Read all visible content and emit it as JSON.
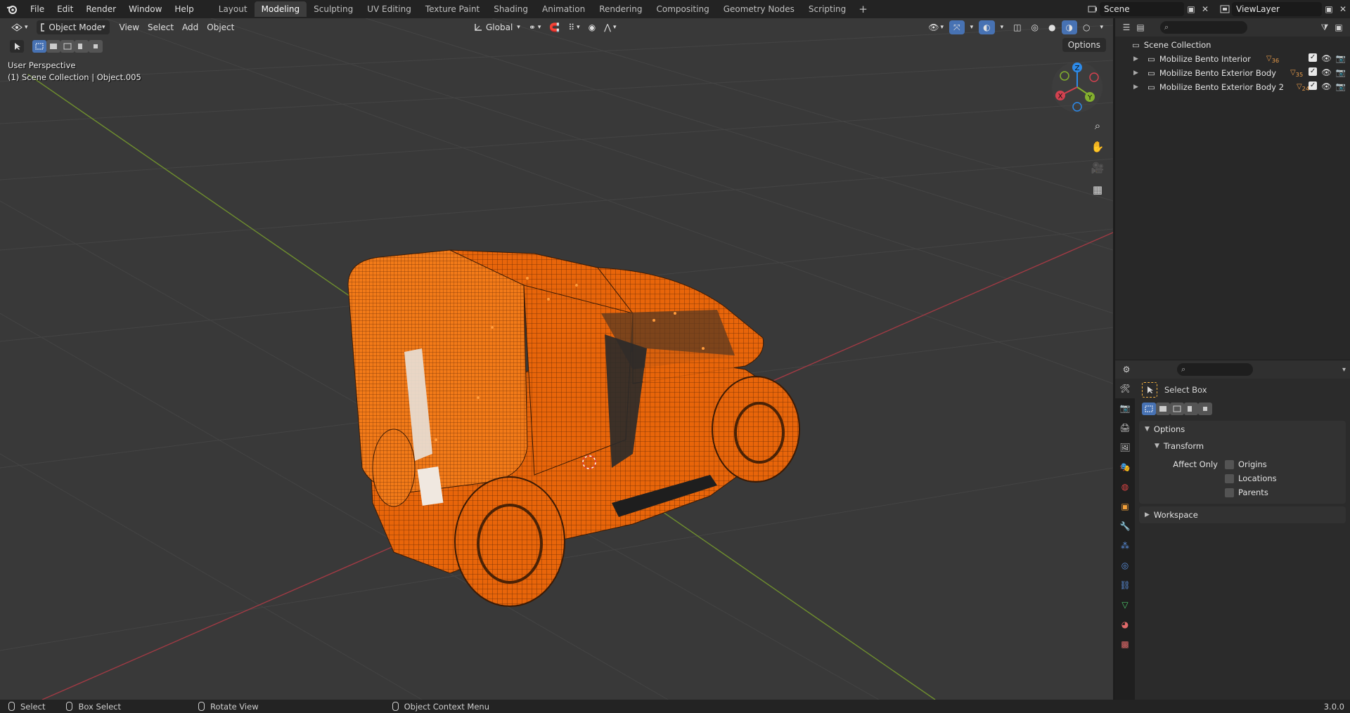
{
  "menu": [
    "File",
    "Edit",
    "Render",
    "Window",
    "Help"
  ],
  "workspaces": [
    "Layout",
    "Modeling",
    "Sculpting",
    "UV Editing",
    "Texture Paint",
    "Shading",
    "Animation",
    "Rendering",
    "Compositing",
    "Geometry Nodes",
    "Scripting"
  ],
  "active_workspace": "Modeling",
  "scene_name": "Scene",
  "view_layer": "ViewLayer",
  "viewport": {
    "mode": "Object Mode",
    "menus": [
      "View",
      "Select",
      "Add",
      "Object"
    ],
    "transform_orientation": "Global",
    "options_label": "Options",
    "perspective_label": "User Perspective",
    "collection_label": "(1) Scene Collection | Object.005",
    "gizmo_axes": {
      "x": "X",
      "y": "Y",
      "z": "Z"
    }
  },
  "outliner": {
    "root": "Scene Collection",
    "items": [
      {
        "label": "Mobilize Bento Interior",
        "badge": "36"
      },
      {
        "label": "Mobilize Bento Exterior Body",
        "badge": "35"
      },
      {
        "label": "Mobilize Bento Exterior Body 2",
        "badge": "24"
      }
    ]
  },
  "properties": {
    "tool_name": "Select Box",
    "options_panel": "Options",
    "transform_panel": "Transform",
    "affect_only_label": "Affect Only",
    "checkboxes": [
      "Origins",
      "Locations",
      "Parents"
    ],
    "workspace_panel": "Workspace"
  },
  "status": {
    "select": "Select",
    "box_select": "Box Select",
    "rotate_view": "Rotate View",
    "context_menu": "Object Context Menu",
    "version": "3.0.0"
  },
  "colors": {
    "accent": "#4772b3",
    "selection_orange": "#f26b0a",
    "axis_x": "#d3414f",
    "axis_y": "#83b02e",
    "axis_z": "#2d8bea"
  }
}
